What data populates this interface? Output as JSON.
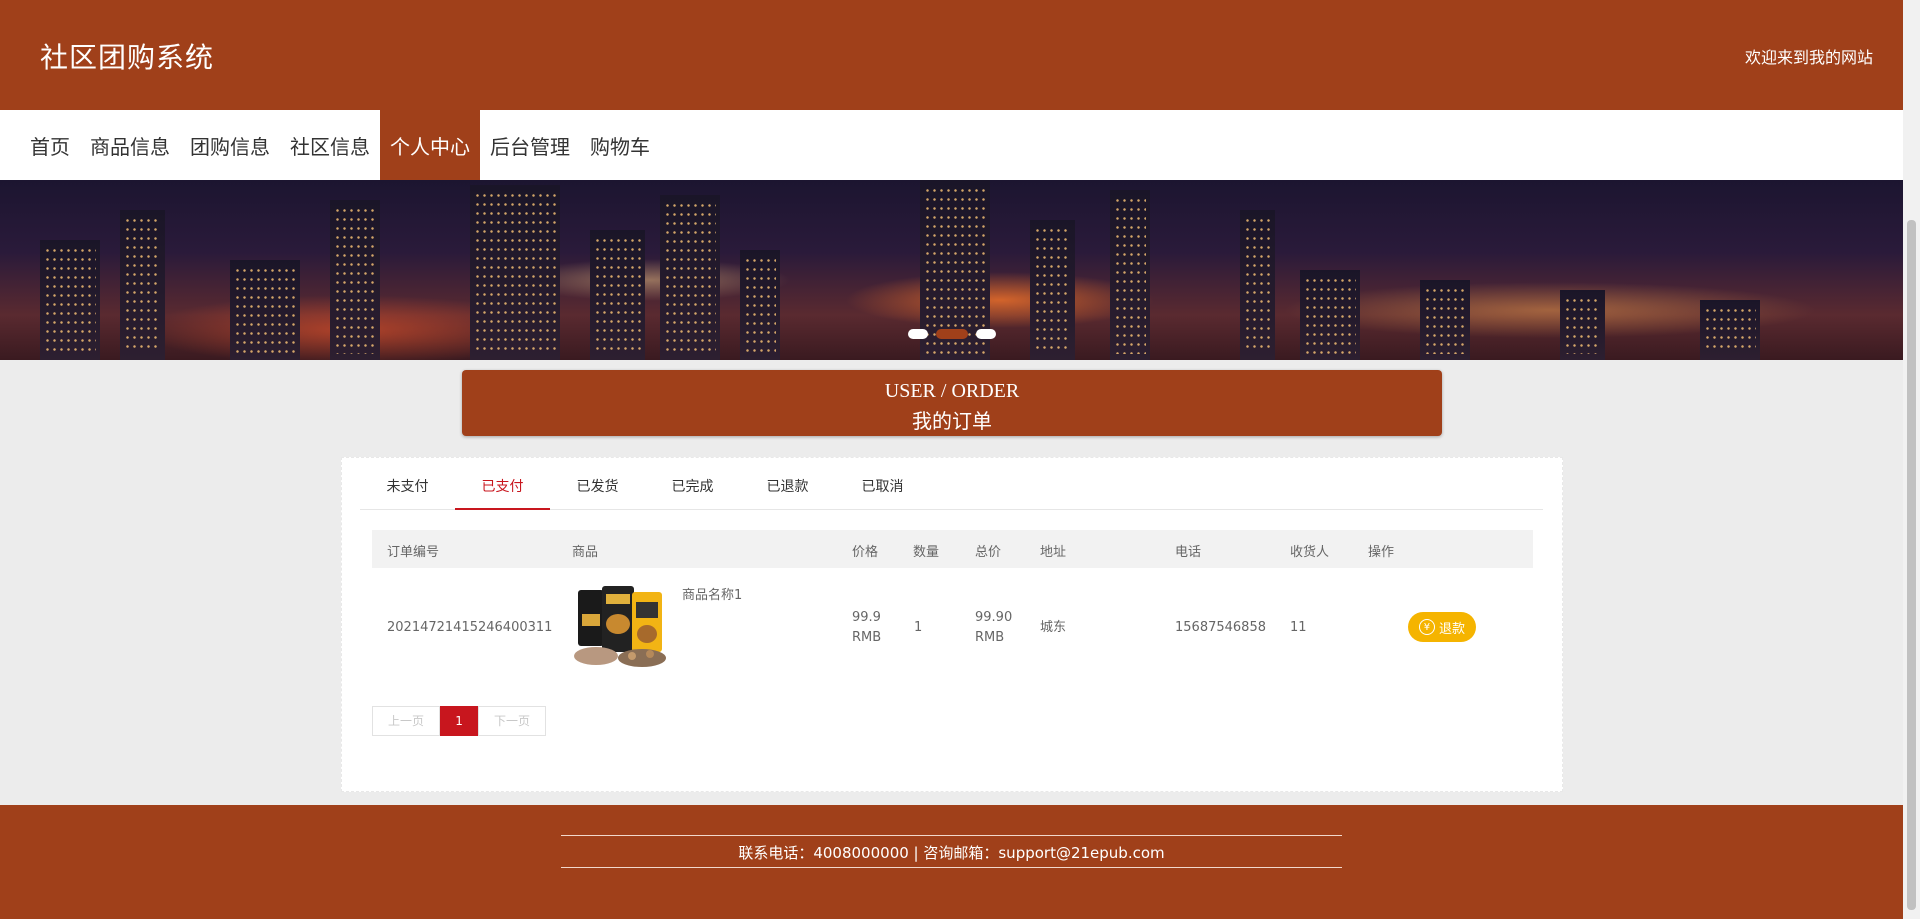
{
  "header": {
    "title": "社区团购系统",
    "welcome": "欢迎来到我的网站"
  },
  "nav": {
    "items": [
      {
        "label": "首页"
      },
      {
        "label": "商品信息"
      },
      {
        "label": "团购信息"
      },
      {
        "label": "社区信息"
      },
      {
        "label": "个人中心",
        "active": true
      },
      {
        "label": "后台管理"
      },
      {
        "label": "购物车"
      }
    ]
  },
  "page_title": {
    "en": "USER / ORDER",
    "cn": "我的订单"
  },
  "tabs": [
    {
      "label": "未支付"
    },
    {
      "label": "已支付",
      "active": true
    },
    {
      "label": "已发货"
    },
    {
      "label": "已完成"
    },
    {
      "label": "已退款"
    },
    {
      "label": "已取消"
    }
  ],
  "table": {
    "headers": [
      "订单编号",
      "商品",
      "价格",
      "数量",
      "总价",
      "地址",
      "电话",
      "收货人",
      "操作"
    ],
    "rows": [
      {
        "order_no": "20214721415246400311",
        "product_name": "商品名称1",
        "product_image": "snack-product-image",
        "price": "99.9",
        "price_unit": "RMB",
        "qty": "1",
        "total": "99.90",
        "total_unit": "RMB",
        "address": "城东",
        "phone": "15687546858",
        "receiver": "11",
        "action_label": "退款",
        "action_icon": "yen-icon"
      }
    ]
  },
  "pager": {
    "prev": "上一页",
    "current": "1",
    "next": "下一页"
  },
  "footer": {
    "text": "联系电话：4008000000 | 咨询邮箱：support@21epub.com"
  },
  "colors": {
    "brand": "#a0401a",
    "accent": "#c8161e",
    "refund": "#f5b400"
  }
}
